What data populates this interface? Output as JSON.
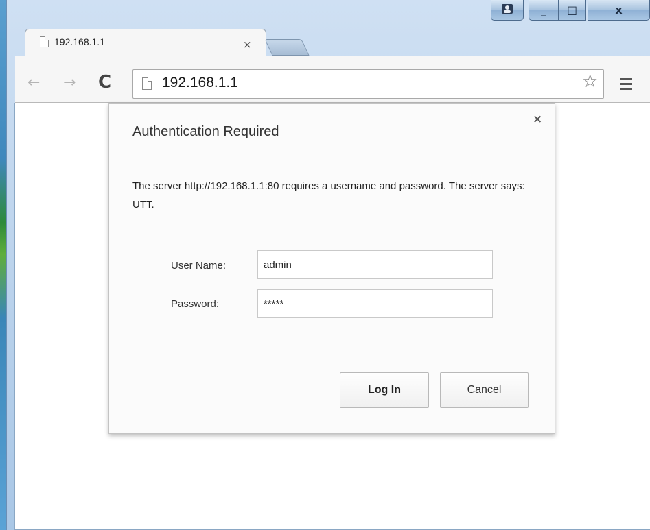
{
  "tab": {
    "title": "192.168.1.1",
    "close_glyph": "×"
  },
  "omnibox": {
    "url": "192.168.1.1"
  },
  "toolbar": {
    "back_glyph": "←",
    "forward_glyph": "→",
    "reload_glyph": "C",
    "star_glyph": "☆"
  },
  "window": {
    "minimize_glyph": "_",
    "maximize_glyph": "□",
    "close_glyph": "x"
  },
  "dialog": {
    "title": "Authentication Required",
    "close_glyph": "×",
    "message": "The server http://192.168.1.1:80 requires a username and password. The server says: UTT.",
    "username_label": "User Name:",
    "username_value": "admin",
    "password_label": "Password:",
    "password_value": "*****",
    "login_label": "Log In",
    "cancel_label": "Cancel"
  },
  "icons": {
    "profile": "profile-icon",
    "page": "page-icon",
    "star": "star-icon",
    "menu": "menu-icon"
  },
  "colors": {
    "window_frame": "#a9c7e6",
    "toolbar_bg": "#f6f6f6",
    "dialog_bg": "#fbfbfb"
  }
}
